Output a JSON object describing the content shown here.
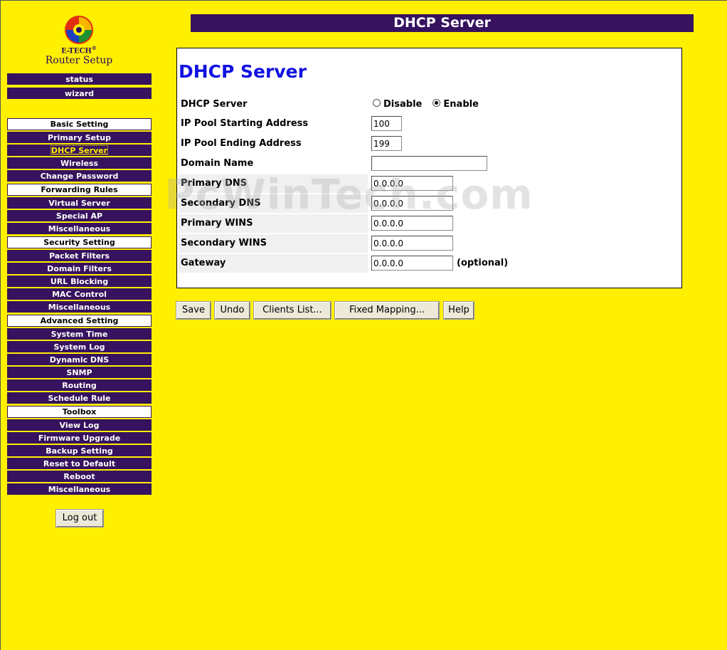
{
  "logo": {
    "brand": "E-TECH",
    "trademark": "®",
    "subtitle": "Router Setup"
  },
  "page_title": "DHCP Server",
  "sidebar": {
    "items": [
      {
        "label": "status",
        "type": "link"
      },
      {
        "label": "wizard",
        "type": "link"
      },
      {
        "label": "Basic Setting",
        "type": "category"
      },
      {
        "label": "Primary Setup",
        "type": "link"
      },
      {
        "label": "DHCP Server",
        "type": "link",
        "active": true
      },
      {
        "label": "Wireless",
        "type": "link"
      },
      {
        "label": "Change Password",
        "type": "link"
      },
      {
        "label": "Forwarding Rules",
        "type": "category"
      },
      {
        "label": "Virtual Server",
        "type": "link"
      },
      {
        "label": "Special AP",
        "type": "link"
      },
      {
        "label": "Miscellaneous",
        "type": "link"
      },
      {
        "label": "Security Setting",
        "type": "category"
      },
      {
        "label": "Packet Filters",
        "type": "link"
      },
      {
        "label": "Domain Filters",
        "type": "link"
      },
      {
        "label": "URL Blocking",
        "type": "link"
      },
      {
        "label": "MAC Control",
        "type": "link"
      },
      {
        "label": "Miscellaneous",
        "type": "link"
      },
      {
        "label": "Advanced Setting",
        "type": "category"
      },
      {
        "label": "System Time",
        "type": "link"
      },
      {
        "label": "System Log",
        "type": "link"
      },
      {
        "label": "Dynamic DNS",
        "type": "link"
      },
      {
        "label": "SNMP",
        "type": "link"
      },
      {
        "label": "Routing",
        "type": "link"
      },
      {
        "label": "Schedule Rule",
        "type": "link"
      },
      {
        "label": "Toolbox",
        "type": "category"
      },
      {
        "label": "View Log",
        "type": "link"
      },
      {
        "label": "Firmware Upgrade",
        "type": "link"
      },
      {
        "label": "Backup Setting",
        "type": "link"
      },
      {
        "label": "Reset to Default",
        "type": "link"
      },
      {
        "label": "Reboot",
        "type": "link"
      },
      {
        "label": "Miscellaneous",
        "type": "link"
      }
    ],
    "logout_label": "Log out"
  },
  "form": {
    "heading": "DHCP Server",
    "dhcp_server": {
      "label": "DHCP Server",
      "disable_label": "Disable",
      "enable_label": "Enable",
      "selected": "Enable"
    },
    "pool_start": {
      "label": "IP Pool Starting Address",
      "value": "100"
    },
    "pool_end": {
      "label": "IP Pool Ending Address",
      "value": "199"
    },
    "domain_name": {
      "label": "Domain Name",
      "value": ""
    },
    "primary_dns": {
      "label": "Primary DNS",
      "value": "0.0.0.0"
    },
    "secondary_dns": {
      "label": "Secondary DNS",
      "value": "0.0.0.0"
    },
    "primary_wins": {
      "label": "Primary WINS",
      "value": "0.0.0.0"
    },
    "secondary_wins": {
      "label": "Secondary WINS",
      "value": "0.0.0.0"
    },
    "gateway": {
      "label": "Gateway",
      "value": "0.0.0.0",
      "note": "(optional)"
    }
  },
  "actions": {
    "save": "Save",
    "undo": "Undo",
    "clients_list": "Clients List...",
    "fixed_mapping": "Fixed Mapping...",
    "help": "Help"
  },
  "watermark": "PcWinTech.com",
  "colors": {
    "background": "#ffef00",
    "nav": "#36125f",
    "heading": "#1212e0"
  },
  "icons": {
    "logo": "swirl-logo-icon"
  }
}
